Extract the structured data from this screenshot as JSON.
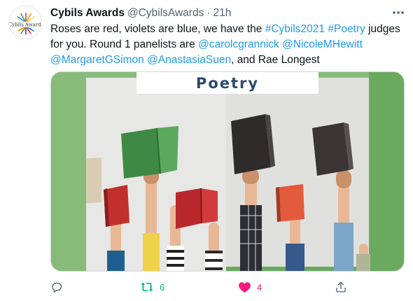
{
  "tweet": {
    "author_name": "Cybils Awards",
    "handle": "@CybilsAwards",
    "separator": "·",
    "time": "21h",
    "avatar_text": "Cybils Awards",
    "text_parts": [
      {
        "t": "Roses are red, violets are blue, we have the ",
        "link": false
      },
      {
        "t": "#Cybils2021",
        "link": true
      },
      {
        "t": " ",
        "link": false
      },
      {
        "t": "#Poetry",
        "link": true
      },
      {
        "t": " judges for you. Round 1 panelists are ",
        "link": false
      },
      {
        "t": "@carolcgrannick",
        "link": true
      },
      {
        "t": " ",
        "link": false
      },
      {
        "t": "@NicoleMHewitt",
        "link": true
      },
      {
        "t": " ",
        "link": false
      },
      {
        "t": "@MargaretGSimon",
        "link": true
      },
      {
        "t": " ",
        "link": false
      },
      {
        "t": "@AnastasiaSuen",
        "link": true
      },
      {
        "t": ", and Rae Longest",
        "link": false
      }
    ],
    "media_label": "Poetry"
  },
  "actions": {
    "reply_count": "",
    "retweet_count": "6",
    "like_count": "4",
    "share_count": ""
  },
  "icons": [
    "more-icon",
    "reply-icon",
    "retweet-icon",
    "heart-icon",
    "share-icon"
  ],
  "colors": {
    "link": "#1d9bf0",
    "retweet": "#00ba7c",
    "like": "#f91880",
    "muted": "#536471",
    "media_frame": "#88bb7a"
  }
}
